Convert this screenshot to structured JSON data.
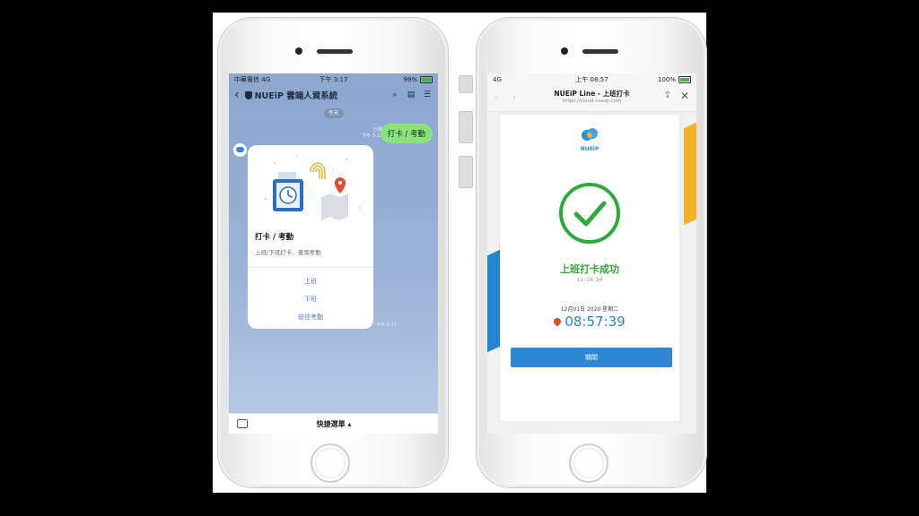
{
  "left_phone": {
    "status": {
      "carrier": "中華電信",
      "network": "4G",
      "time": "下午 3:17",
      "battery": "99%"
    },
    "header": {
      "title": "NUEiP 雲端人資系統"
    },
    "date_pill": "今天",
    "my_message": {
      "text": "打卡 / 考勤",
      "read": "已讀",
      "time": "下午 3:17"
    },
    "card": {
      "title": "打卡 / 考勤",
      "subtitle": "上班/下班打卡．查詢考勤",
      "actions": [
        "上班",
        "下班",
        "前往考勤"
      ],
      "time": "下午 3:17"
    },
    "bottom": {
      "quick_menu": "快捷選單 ▴"
    }
  },
  "right_phone": {
    "status": {
      "network": "4G",
      "time": "上午 08:57",
      "battery": "100%"
    },
    "header": {
      "title": "NUEiP Line - 上班打卡",
      "url": "https://cloud.nueip.com"
    },
    "logo_text": "NUEiP",
    "result": {
      "title": "上班打卡成功",
      "time": "11:18:34",
      "date": "12月01日 2020 星期二",
      "clock": "08:57:39"
    },
    "close_label": "關閉"
  },
  "colors": {
    "line_green": "#8be27a",
    "success_green": "#31a73a",
    "nueip_blue": "#2f86d4",
    "accent_yellow": "#f4b323"
  }
}
